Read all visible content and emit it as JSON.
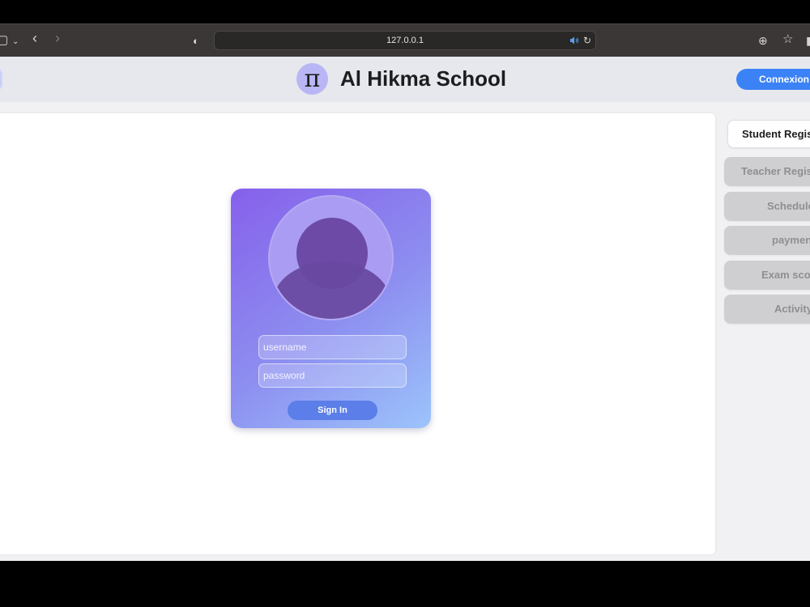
{
  "browser": {
    "url": "127.0.0.1"
  },
  "header": {
    "logo_glyph": "π",
    "school_name": "Al Hikma School",
    "login_button": "Connexion",
    "accent_color": "#3b82f6"
  },
  "login": {
    "username_placeholder": "username",
    "password_placeholder": "password",
    "submit_label": "Sign In"
  },
  "sidebar": {
    "items": [
      {
        "label": "Student Regis",
        "active": true
      },
      {
        "label": "Teacher Regis",
        "active": false
      },
      {
        "label": "Schedule",
        "active": false
      },
      {
        "label": "paymen",
        "active": false
      },
      {
        "label": "Exam sco",
        "active": false
      },
      {
        "label": "Activity",
        "active": false
      }
    ]
  }
}
